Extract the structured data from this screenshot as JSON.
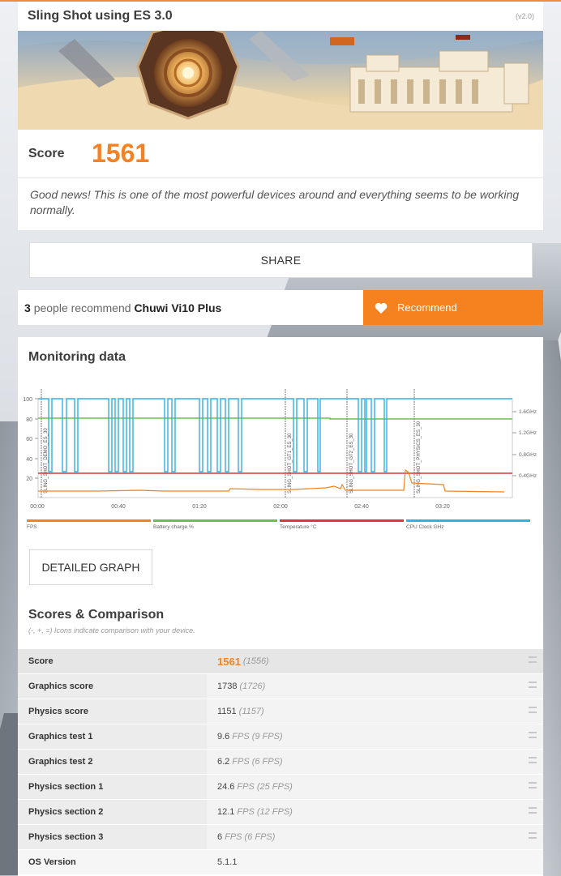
{
  "header": {
    "title": "Sling Shot using ES 3.0",
    "version": "(v2.0)",
    "score_label": "Score",
    "score_value": "1561",
    "message": "Good news! This is one of the most powerful devices around and everything seems to be working normally."
  },
  "share_label": "SHARE",
  "recommend": {
    "count": "3",
    "text": "people recommend",
    "device": "Chuwi Vi10 Plus",
    "button_label": "Recommend"
  },
  "monitoring": {
    "title": "Monitoring data",
    "detailed_graph_label": "DETAILED GRAPH"
  },
  "chart_data": {
    "type": "line",
    "x_ticks": [
      "00:00",
      "00:40",
      "01:20",
      "02:00",
      "02:40",
      "03:20"
    ],
    "y_ticks_left": [
      "100",
      "80",
      "60",
      "40",
      "20"
    ],
    "y_ticks_right": [
      "1.6GHz",
      "1.2GHz",
      "0.8GHz",
      "0.4GHz"
    ],
    "markers": [
      "SLING_SHOT_DEMO_ES_30",
      "SLING_SHOT_GT1_ES_30",
      "SLING_SHOT_GT2_ES_30",
      "SLING_SHOT_PHYSICS_ES_30"
    ],
    "legend": [
      {
        "name": "FPS",
        "color": "#f5821f"
      },
      {
        "name": "Battery charge %",
        "color": "#6cc04a"
      },
      {
        "name": "Temperature °C",
        "color": "#d9363e"
      },
      {
        "name": "CPU Clock GHz",
        "color": "#2fb0e6"
      }
    ]
  },
  "comparison": {
    "title": "Scores & Comparison",
    "subtitle": "(-, +, =) Icons indicate comparison with your device.",
    "rows": [
      {
        "label": "Score",
        "value": "1561",
        "unit": "",
        "compare": "(1556)"
      },
      {
        "label": "Graphics score",
        "value": "1738",
        "unit": "",
        "compare": "(1726)"
      },
      {
        "label": "Physics score",
        "value": "1151",
        "unit": "",
        "compare": "(1157)"
      },
      {
        "label": "Graphics test 1",
        "value": "9.6",
        "unit": "FPS",
        "compare": "(9 FPS)"
      },
      {
        "label": "Graphics test 2",
        "value": "6.2",
        "unit": "FPS",
        "compare": "(6 FPS)"
      },
      {
        "label": "Physics section 1",
        "value": "24.6",
        "unit": "FPS",
        "compare": "(25 FPS)"
      },
      {
        "label": "Physics section 2",
        "value": "12.1",
        "unit": "FPS",
        "compare": "(12 FPS)"
      },
      {
        "label": "Physics section 3",
        "value": "6",
        "unit": "FPS",
        "compare": "(6 FPS)"
      },
      {
        "label": "OS Version",
        "value": "5.1.1",
        "unit": "",
        "compare": ""
      }
    ]
  }
}
